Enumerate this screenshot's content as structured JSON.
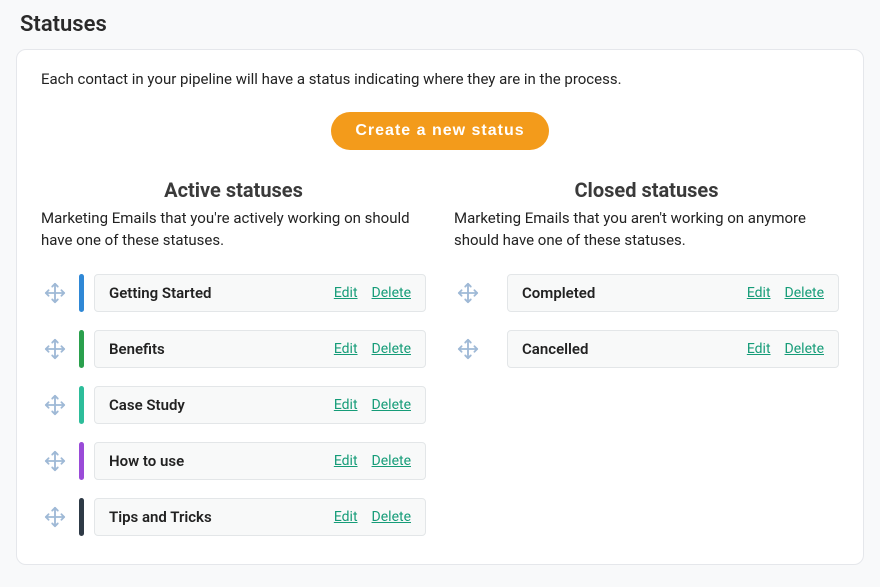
{
  "page_title": "Statuses",
  "intro": "Each contact in your pipeline will have a status indicating where they are in the process.",
  "create_button_label": "Create a new status",
  "actions": {
    "edit": "Edit",
    "delete": "Delete"
  },
  "colors": {
    "accent_button": "#f39b1b",
    "link": "#159c78"
  },
  "active": {
    "title": "Active statuses",
    "description": "Marketing Emails that you're actively working on should have one of these statuses.",
    "items": [
      {
        "name": "Getting Started",
        "color": "#2f88d6"
      },
      {
        "name": "Benefits",
        "color": "#2aa04d"
      },
      {
        "name": "Case Study",
        "color": "#2dbd9a"
      },
      {
        "name": "How to use",
        "color": "#9a4bd8"
      },
      {
        "name": "Tips and Tricks",
        "color": "#2e3a46"
      }
    ]
  },
  "closed": {
    "title": "Closed statuses",
    "description": "Marketing Emails that you aren't working on anymore should have one of these statuses.",
    "items": [
      {
        "name": "Completed",
        "color": "transparent"
      },
      {
        "name": "Cancelled",
        "color": "transparent"
      }
    ]
  }
}
